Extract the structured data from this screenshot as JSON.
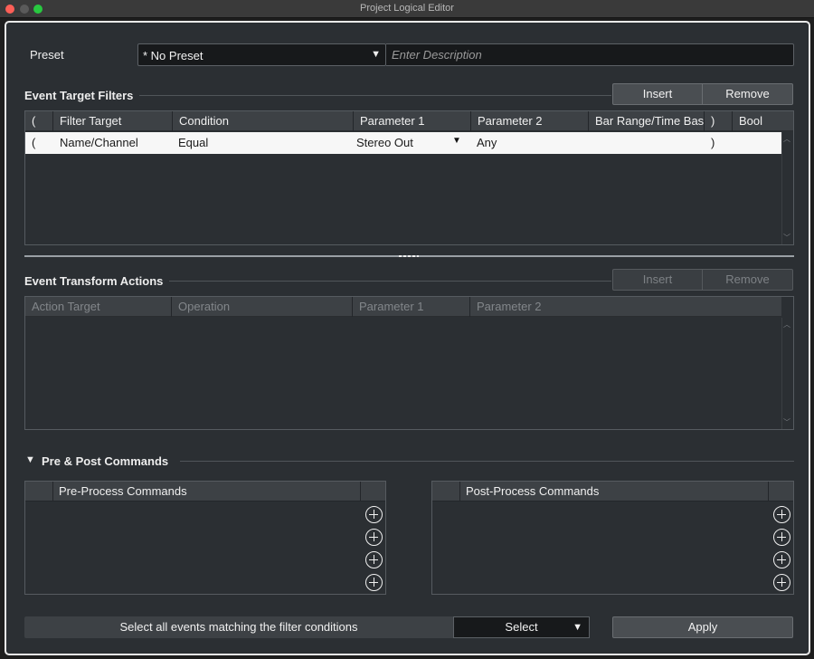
{
  "window": {
    "title": "Project Logical Editor"
  },
  "preset": {
    "label": "Preset",
    "value": "* No Preset",
    "description_placeholder": "Enter Description"
  },
  "filters": {
    "title": "Event Target Filters",
    "insert_label": "Insert",
    "remove_label": "Remove",
    "columns": [
      "(",
      "Filter Target",
      "Condition",
      "Parameter 1",
      "Parameter 2",
      "Bar Range/Time Bas",
      ")",
      "Bool"
    ],
    "rows": [
      {
        "open": "(",
        "target": "Name/Channel",
        "condition": "Equal",
        "param1": "Stereo Out",
        "param2": "Any",
        "range": "",
        "close": ")",
        "bool": ""
      }
    ]
  },
  "actions": {
    "title": "Event Transform Actions",
    "insert_label": "Insert",
    "remove_label": "Remove",
    "columns": [
      "Action Target",
      "Operation",
      "Parameter 1",
      "Parameter 2"
    ]
  },
  "commands": {
    "title": "Pre & Post Commands",
    "pre_header": "Pre-Process Commands",
    "post_header": "Post-Process Commands"
  },
  "footer": {
    "status_text": "Select all events matching the filter conditions",
    "mode_value": "Select",
    "apply_label": "Apply"
  },
  "colors": {
    "panel_bg": "#2b2f33",
    "header_bg": "#3d4145",
    "selected_row": "#f7f7f7",
    "close_button": "#fe5f57",
    "zoom_button": "#28c840"
  }
}
